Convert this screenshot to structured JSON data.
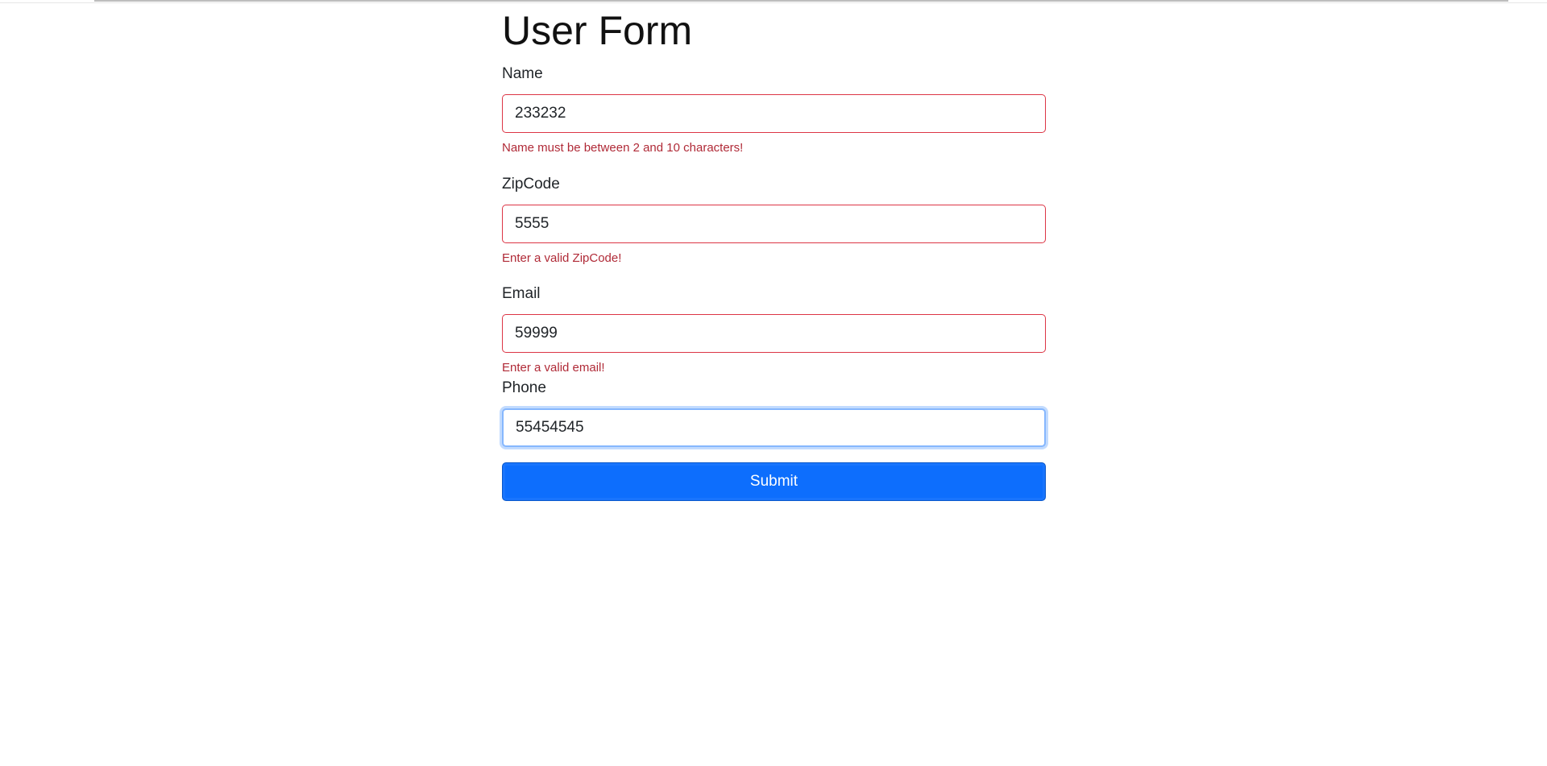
{
  "form": {
    "title": "User Form",
    "fields": [
      {
        "label": "Name",
        "value": "233232",
        "error": "Name must be between 2 and 10 characters!"
      },
      {
        "label": "ZipCode",
        "value": "5555",
        "error": "Enter a valid ZipCode!"
      },
      {
        "label": "Email",
        "value": "59999",
        "error": "Enter a valid email!"
      },
      {
        "label": "Phone",
        "value": "55454545",
        "error": ""
      }
    ],
    "submit_label": "Submit"
  },
  "colors": {
    "primary": "#0d6efd",
    "error": "#dc3545",
    "focus": "#86b7fe"
  }
}
